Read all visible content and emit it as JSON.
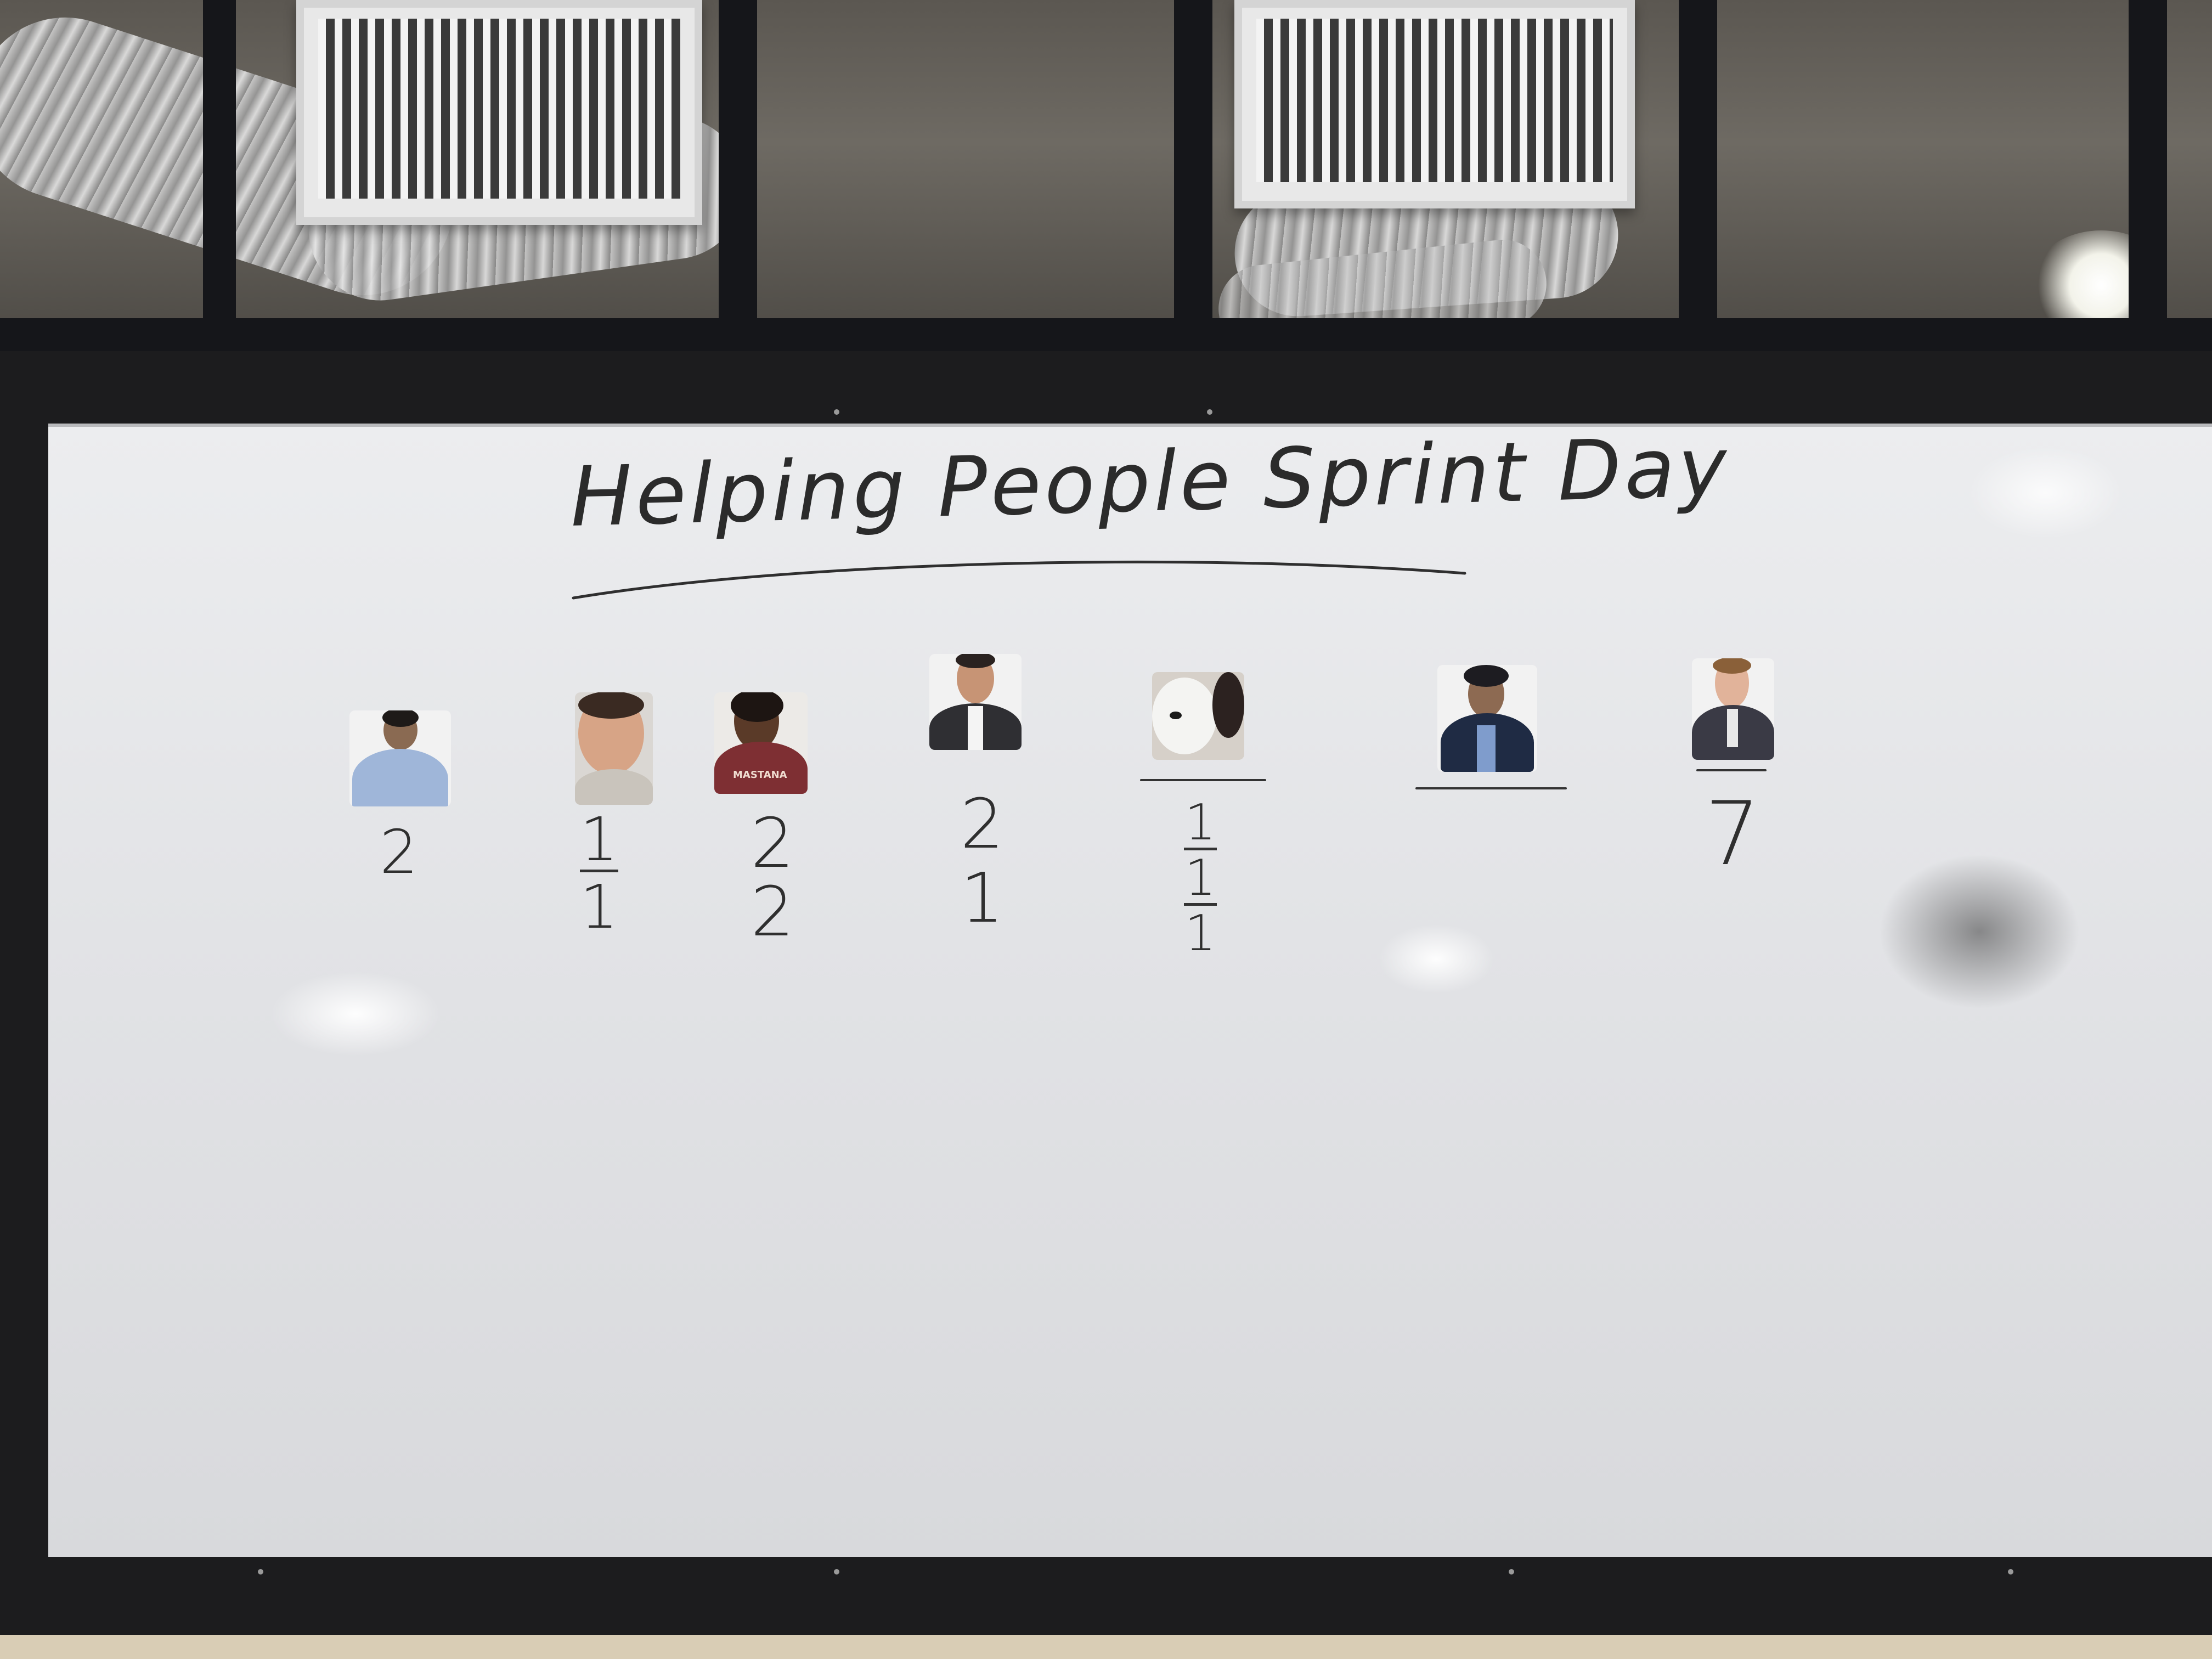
{
  "board": {
    "title": "Helping People Sprint Day"
  },
  "people": [
    {
      "id": "person-1",
      "tallies": [
        "2"
      ],
      "underlined_first": false
    },
    {
      "id": "person-2",
      "tallies": [
        "1",
        "1"
      ],
      "underlined_first": true
    },
    {
      "id": "person-3",
      "tallies": [
        "2",
        "2"
      ],
      "underlined_first": false
    },
    {
      "id": "person-4",
      "tallies": [
        "2",
        "1"
      ],
      "underlined_first": false
    },
    {
      "id": "person-5",
      "tallies": [
        "1",
        "1",
        "1"
      ],
      "underlined_first": true
    },
    {
      "id": "person-6",
      "tallies": [],
      "underlined_first": false
    },
    {
      "id": "person-7",
      "tallies": [
        "7"
      ],
      "underlined_first": false
    }
  ],
  "shirt_text": "MASTANA",
  "colors": {
    "board": "#e6e7ea",
    "frame": "#1c1c1e",
    "marker": "#2f2f2f"
  }
}
